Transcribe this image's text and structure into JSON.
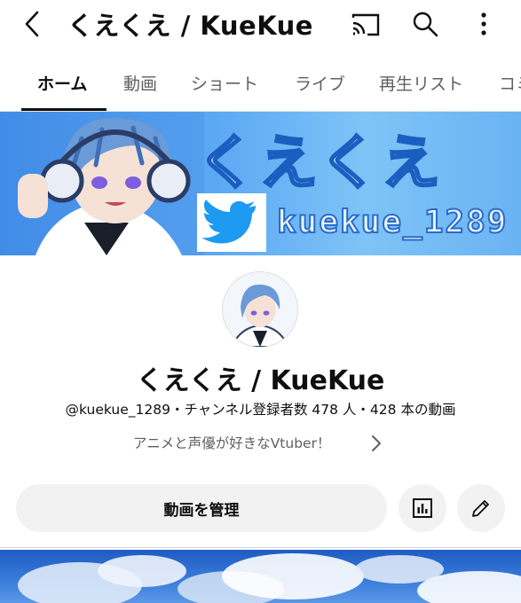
{
  "header": {
    "title": "くえくえ / KueKue",
    "icons": [
      "back-icon",
      "cast-icon",
      "search-icon",
      "more-vert-icon"
    ]
  },
  "tabs": [
    {
      "label": "ホーム",
      "active": true
    },
    {
      "label": "動画",
      "active": false
    },
    {
      "label": "ショート",
      "active": false
    },
    {
      "label": "ライブ",
      "active": false
    },
    {
      "label": "再生リスト",
      "active": false
    },
    {
      "label": "コミ",
      "active": false
    }
  ],
  "banner": {
    "title": "くえくえ",
    "handle": "kuekue_1289",
    "icon": "twitter-bird-icon"
  },
  "channel": {
    "name": "くえくえ / KueKue",
    "meta": "@kuekue_1289・チャンネル登録者数 478 人・428 本の動画",
    "description": "アニメと声優が好きなVtuber！"
  },
  "actions": {
    "manage_label": "動画を管理",
    "icons": [
      "analytics-icon",
      "edit-pencil-icon"
    ]
  },
  "colors": {
    "accent": "#0f0f0f",
    "muted_text": "#606060",
    "button_bg": "#f2f2f2",
    "banner_blue": "#3d8be8"
  }
}
